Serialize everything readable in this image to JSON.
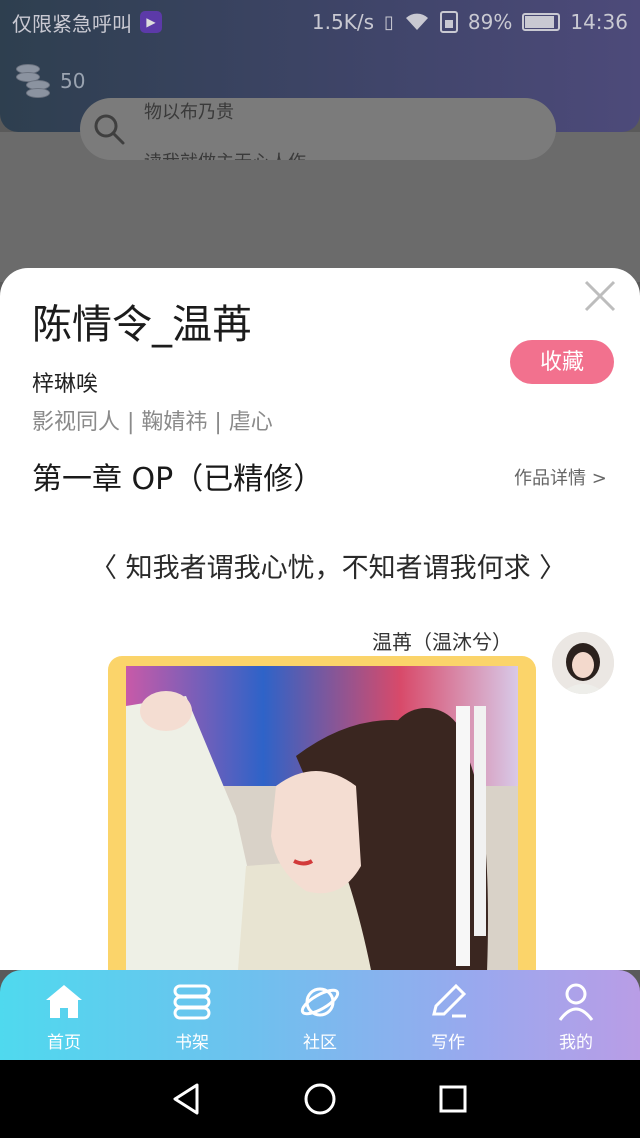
{
  "status_bar": {
    "carrier_text": "仅限紧急呼叫",
    "net_speed": "1.5K/s",
    "battery": "89%",
    "battery_level": 0.89,
    "time": "14:36"
  },
  "background": {
    "coin_count": "50",
    "search_line1": "物以布乃贵",
    "search_line2": "读我就做主无心人作"
  },
  "sheet": {
    "title": "陈情令_温苒",
    "author": "梓琳唉",
    "tags": "影视同人 | 鞠婧祎 | 虐心",
    "favorite_label": "收藏",
    "chapter_title": "第一章  OP（已精修）",
    "details_link": "作品详情 >",
    "quote": "〈 知我者谓我心忧，不知者谓我何求 〉",
    "speaker": "温苒（温沐兮）"
  },
  "tabbar": {
    "items": [
      {
        "label": "首页",
        "icon": "home-icon"
      },
      {
        "label": "书架",
        "icon": "bookshelf-icon"
      },
      {
        "label": "社区",
        "icon": "planet-icon"
      },
      {
        "label": "写作",
        "icon": "pen-icon"
      },
      {
        "label": "我的",
        "icon": "user-icon"
      }
    ]
  },
  "navbar": {
    "icons": [
      "back-icon",
      "home-circle-icon",
      "recents-icon"
    ]
  },
  "colors": {
    "accent_pink": "#f2718e",
    "frame_yellow": "#fbd46a",
    "tab_gradient_start": "#4fd9ee",
    "tab_gradient_end": "#b99de6"
  }
}
